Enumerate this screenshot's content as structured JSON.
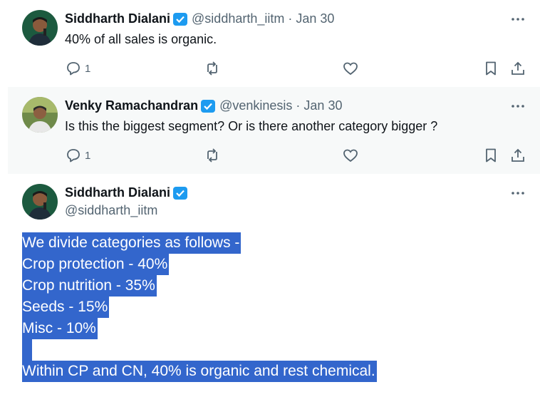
{
  "tweets": [
    {
      "name": "Siddharth Dialani",
      "handle": "@siddharth_iitm",
      "separator": "·",
      "date": "Jan 30",
      "text": "40% of all sales is organic.",
      "reply_count": "1"
    },
    {
      "name": "Venky Ramachandran",
      "handle": "@venkinesis",
      "separator": "·",
      "date": "Jan 30",
      "text": "Is this the biggest segment? Or is there another category bigger ?",
      "reply_count": "1"
    }
  ],
  "main_tweet": {
    "name": "Siddharth Dialani",
    "handle": "@siddharth_iitm",
    "lines": [
      "We divide categories as follows -",
      "Crop protection - 40%",
      "Crop nutrition - 35%",
      "Seeds - 15%",
      "Misc - 10%",
      "",
      "Within CP and CN, 40% is organic and rest chemical."
    ]
  },
  "colors": {
    "verified": "#1d9bf0",
    "selection": "#3366cc",
    "muted": "#536471"
  },
  "icons": {
    "reply": "speech-bubble",
    "retweet": "arrows-loop",
    "like": "heart",
    "bookmark": "bookmark",
    "share": "upload-arrow",
    "more": "three-dots"
  }
}
